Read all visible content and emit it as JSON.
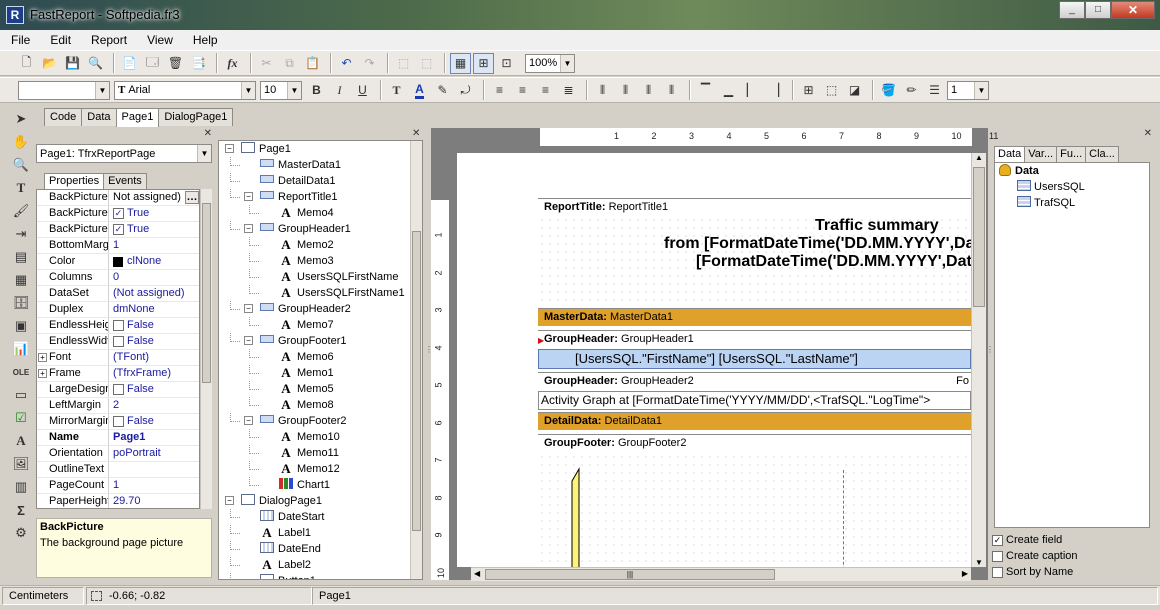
{
  "window": {
    "title": "FastReport - Softpedia.fr3",
    "app_icon": "fastreport-icon",
    "buttons": {
      "minimize": "_",
      "maximize": "□",
      "close": "✕"
    }
  },
  "menu": [
    "File",
    "Edit",
    "Report",
    "View",
    "Help"
  ],
  "toolbar": {
    "zoom": "100%",
    "font_name": "Arial",
    "font_size": "10",
    "frame_width": "1",
    "style_combo": ""
  },
  "tabs": [
    "Code",
    "Data",
    "Page1",
    "DialogPage1"
  ],
  "active_tab": "Page1",
  "inspector": {
    "object": "Page1: TfrxReportPage",
    "tabs": [
      "Properties",
      "Events"
    ],
    "properties": [
      {
        "name": "BackPicture",
        "value": "Not assigned)",
        "type": "ellipsis"
      },
      {
        "name": "BackPictureP",
        "value": "True",
        "type": "check"
      },
      {
        "name": "BackPictureVi",
        "value": "True",
        "type": "check"
      },
      {
        "name": "BottomMargin",
        "value": "1"
      },
      {
        "name": "Color",
        "value": "clNone",
        "type": "color"
      },
      {
        "name": "Columns",
        "value": "0"
      },
      {
        "name": "DataSet",
        "value": "(Not assigned)"
      },
      {
        "name": "Duplex",
        "value": "dmNone"
      },
      {
        "name": "EndlessHeigh",
        "value": "False",
        "type": "uncheck"
      },
      {
        "name": "EndlessWidth",
        "value": "False",
        "type": "uncheck"
      },
      {
        "name": "Font",
        "value": "(TFont)",
        "type": "expand"
      },
      {
        "name": "Frame",
        "value": "(TfrxFrame)",
        "type": "expand"
      },
      {
        "name": "LargeDesignH",
        "value": "False",
        "type": "uncheck"
      },
      {
        "name": "LeftMargin",
        "value": "2"
      },
      {
        "name": "MirrorMargins",
        "value": "False",
        "type": "uncheck"
      },
      {
        "name": "Name",
        "value": "Page1",
        "type": "bold"
      },
      {
        "name": "Orientation",
        "value": "poPortrait"
      },
      {
        "name": "OutlineText",
        "value": ""
      },
      {
        "name": "PageCount",
        "value": "1"
      },
      {
        "name": "PaperHeight",
        "value": "29.70"
      }
    ],
    "description": {
      "title": "BackPicture",
      "text": "The background page picture"
    }
  },
  "tree": [
    {
      "label": "Page1",
      "level": 0,
      "icon": "page-icon",
      "expander": true
    },
    {
      "label": "MasterData1",
      "level": 1,
      "icon": "band-icon"
    },
    {
      "label": "DetailData1",
      "level": 1,
      "icon": "band-icon"
    },
    {
      "label": "ReportTitle1",
      "level": 1,
      "icon": "band-icon",
      "expander": true
    },
    {
      "label": "Memo4",
      "level": 2,
      "icon": "memo-icon"
    },
    {
      "label": "GroupHeader1",
      "level": 1,
      "icon": "band-icon",
      "expander": true
    },
    {
      "label": "Memo2",
      "level": 2,
      "icon": "memo-icon"
    },
    {
      "label": "Memo3",
      "level": 2,
      "icon": "memo-icon"
    },
    {
      "label": "UsersSQLFirstName",
      "level": 2,
      "icon": "memo-icon"
    },
    {
      "label": "UsersSQLFirstName1",
      "level": 2,
      "icon": "memo-icon"
    },
    {
      "label": "GroupHeader2",
      "level": 1,
      "icon": "band-icon",
      "expander": true
    },
    {
      "label": "Memo7",
      "level": 2,
      "icon": "memo-icon"
    },
    {
      "label": "GroupFooter1",
      "level": 1,
      "icon": "band-icon",
      "expander": true
    },
    {
      "label": "Memo6",
      "level": 2,
      "icon": "memo-icon"
    },
    {
      "label": "Memo1",
      "level": 2,
      "icon": "memo-icon"
    },
    {
      "label": "Memo5",
      "level": 2,
      "icon": "memo-icon"
    },
    {
      "label": "Memo8",
      "level": 2,
      "icon": "memo-icon"
    },
    {
      "label": "GroupFooter2",
      "level": 1,
      "icon": "band-icon",
      "expander": true
    },
    {
      "label": "Memo10",
      "level": 2,
      "icon": "memo-icon"
    },
    {
      "label": "Memo11",
      "level": 2,
      "icon": "memo-icon"
    },
    {
      "label": "Memo12",
      "level": 2,
      "icon": "memo-icon"
    },
    {
      "label": "Chart1",
      "level": 2,
      "icon": "chart-icon"
    },
    {
      "label": "DialogPage1",
      "level": 0,
      "icon": "dialog-page-icon",
      "expander": true
    },
    {
      "label": "DateStart",
      "level": 1,
      "icon": "date-icon"
    },
    {
      "label": "Label1",
      "level": 1,
      "icon": "memo-icon"
    },
    {
      "label": "DateEnd",
      "level": 1,
      "icon": "date-icon"
    },
    {
      "label": "Label2",
      "level": 1,
      "icon": "memo-icon"
    },
    {
      "label": "Button1",
      "level": 1,
      "icon": "button-icon"
    }
  ],
  "ruler": {
    "h": [
      "1",
      "2",
      "3",
      "4",
      "5",
      "6",
      "7",
      "8",
      "9",
      "10",
      "11"
    ],
    "v": [
      "1",
      "2",
      "3",
      "4",
      "5",
      "6",
      "7",
      "8",
      "9",
      "10"
    ]
  },
  "design": {
    "report_title": {
      "type": "ReportTitle:",
      "name": "ReportTitle1",
      "lines": [
        "Traffic summary",
        "from [FormatDateTime('DD.MM.YYYY',Da",
        "[FormatDateTime('DD.MM.YYYY',Dat"
      ]
    },
    "master": {
      "type": "MasterData:",
      "name": "MasterData1"
    },
    "group1": {
      "type": "GroupHeader:",
      "name": "GroupHeader1",
      "memo": "[UsersSQL.\"FirstName\"] [UsersSQL.\"LastName\"]"
    },
    "group2": {
      "type": "GroupHeader:",
      "name": "GroupHeader2",
      "right": "Fo",
      "memo": "Activity Graph at [FormatDateTime('YYYY/MM/DD',<TrafSQL.\"LogTime\">"
    },
    "detail": {
      "type": "DetailData:",
      "name": "DetailData1"
    },
    "footer": {
      "type": "GroupFooter:",
      "name": "GroupFooter2"
    }
  },
  "data_panel": {
    "tabs": [
      "Data",
      "Var...",
      "Fu...",
      "Cla..."
    ],
    "root": "Data",
    "items": [
      "UsersSQL",
      "TrafSQL"
    ],
    "options": [
      {
        "label": "Create field",
        "checked": true
      },
      {
        "label": "Create caption",
        "checked": false
      },
      {
        "label": "Sort by Name",
        "checked": false
      }
    ]
  },
  "status": {
    "units": "Centimeters",
    "coords": "-0.66; -0.82",
    "page": "Page1"
  },
  "colors": {
    "band_orange": "#e0a12a",
    "memo_blue": "#bcd4f4"
  }
}
